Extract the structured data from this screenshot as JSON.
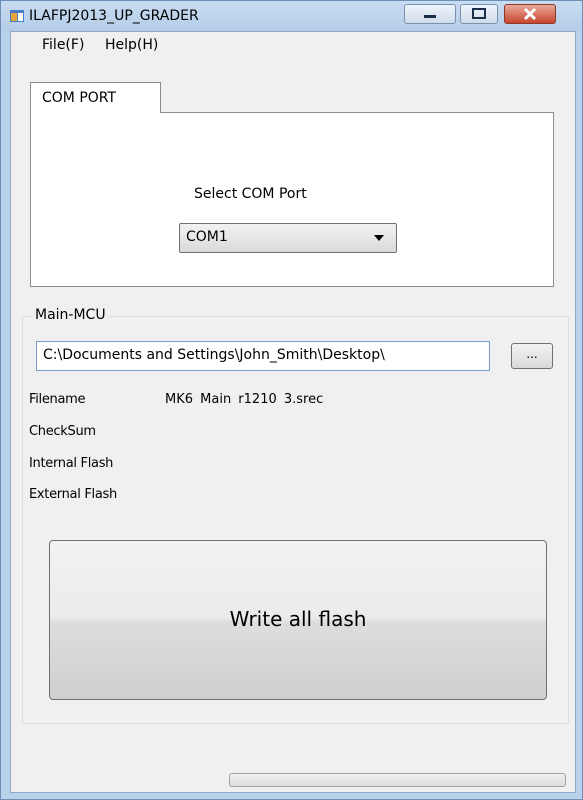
{
  "window": {
    "title": "ILAFPJ2013_UP_GRADER",
    "icon": "app-window-icon",
    "buttons": [
      "minimize-icon",
      "maximize-icon",
      "close-icon"
    ]
  },
  "menu": {
    "file": "File(F)",
    "help": "Help(H)"
  },
  "tabs": [
    {
      "label": "COM PORT"
    }
  ],
  "com_port": {
    "label": "Select COM Port",
    "selected": "COM1"
  },
  "main_mcu": {
    "legend": "Main-MCU",
    "path": "C:\\Documents and Settings\\John_Smith\\Desktop\\",
    "browse_label": "...",
    "info": [
      {
        "label": "Filename",
        "value": "MK6 Main r1210 3.srec"
      },
      {
        "label": "CheckSum",
        "value": ""
      },
      {
        "label": "Internal Flash",
        "value": ""
      },
      {
        "label": "External Flash",
        "value": ""
      }
    ],
    "write_button": "Write all flash"
  },
  "progress": {
    "value": 0
  },
  "colors": {
    "titlebar": "#b9d1ea",
    "close_button": "#c7452d",
    "client_bg": "#f0f0f0"
  }
}
